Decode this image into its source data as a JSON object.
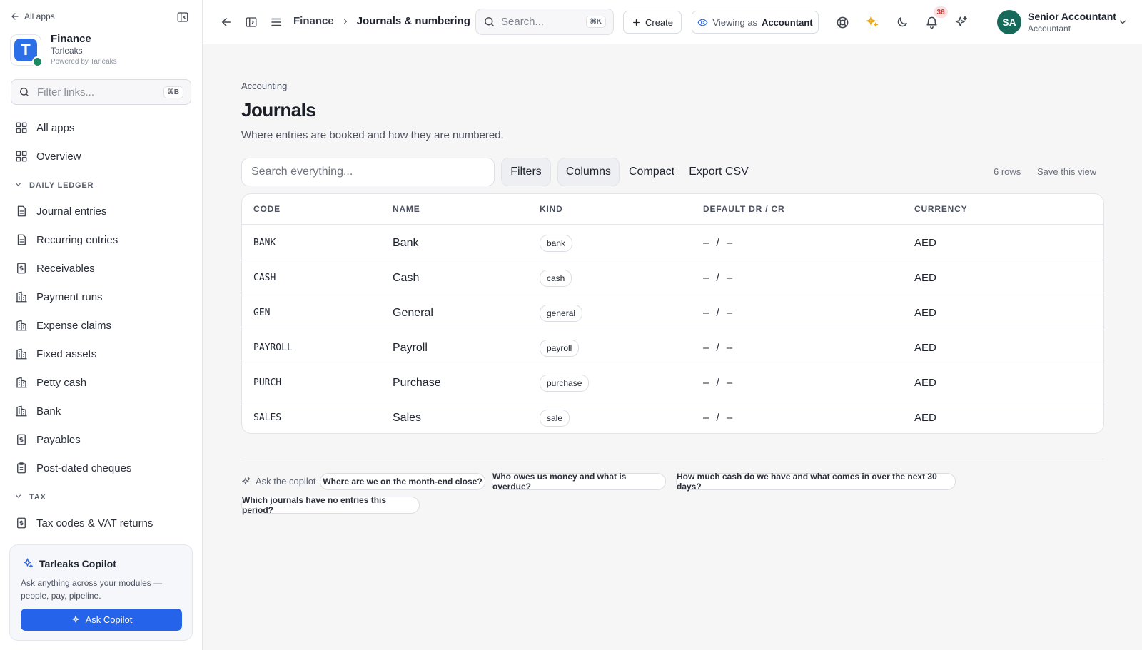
{
  "sidebar": {
    "back_label": "All apps",
    "brand": {
      "logo_letter": "T",
      "title": "Finance",
      "subtitle": "Tarleaks",
      "powered": "Powered by Tarleaks"
    },
    "filter": {
      "placeholder": "Filter links...",
      "shortcut": "⌘B"
    },
    "top_items": [
      {
        "label": "All apps",
        "icon": "grid-icon"
      },
      {
        "label": "Overview",
        "icon": "grid-icon"
      }
    ],
    "sections": [
      {
        "title": "DAILY LEDGER",
        "items": [
          {
            "label": "Journal entries",
            "icon": "document-icon"
          },
          {
            "label": "Recurring entries",
            "icon": "document-icon"
          },
          {
            "label": "Receivables",
            "icon": "dollar-document-icon"
          },
          {
            "label": "Payment runs",
            "icon": "building-icon"
          },
          {
            "label": "Expense claims",
            "icon": "building-icon"
          },
          {
            "label": "Fixed assets",
            "icon": "building-icon"
          },
          {
            "label": "Petty cash",
            "icon": "building-icon"
          },
          {
            "label": "Bank",
            "icon": "building-icon"
          },
          {
            "label": "Payables",
            "icon": "dollar-document-icon"
          },
          {
            "label": "Post-dated cheques",
            "icon": "clipboard-icon"
          }
        ]
      },
      {
        "title": "TAX",
        "items": [
          {
            "label": "Tax codes & VAT returns",
            "icon": "dollar-document-icon"
          }
        ]
      }
    ],
    "copilot": {
      "title": "Tarleaks Copilot",
      "desc": "Ask anything across your modules — people, pay, pipeline.",
      "button": "Ask Copilot"
    }
  },
  "topbar": {
    "breadcrumb": [
      "Finance",
      "Journals & numbering"
    ],
    "search": {
      "placeholder": "Search...",
      "shortcut": "⌘K"
    },
    "create_label": "Create",
    "viewing_prefix": "Viewing as",
    "viewing_role": "Accountant",
    "notifications_count": "36",
    "user": {
      "initials": "SA",
      "name": "Senior Accountant",
      "role": "Accountant"
    }
  },
  "page": {
    "kicker": "Accounting",
    "title": "Journals",
    "description": "Where entries are booked and how they are numbered.",
    "toolbar": {
      "search_placeholder": "Search everything...",
      "filters": "Filters",
      "columns": "Columns",
      "compact": "Compact",
      "export": "Export CSV",
      "rows_count": "6 rows",
      "save_view": "Save this view"
    },
    "table": {
      "columns": [
        "CODE",
        "NAME",
        "KIND",
        "DEFAULT DR / CR",
        "CURRENCY"
      ],
      "rows": [
        {
          "code": "BANK",
          "name": "Bank",
          "kind": "bank",
          "drcr": "– / –",
          "currency": "AED"
        },
        {
          "code": "CASH",
          "name": "Cash",
          "kind": "cash",
          "drcr": "– / –",
          "currency": "AED"
        },
        {
          "code": "GEN",
          "name": "General",
          "kind": "general",
          "drcr": "– / –",
          "currency": "AED"
        },
        {
          "code": "PAYROLL",
          "name": "Payroll",
          "kind": "payroll",
          "drcr": "– / –",
          "currency": "AED"
        },
        {
          "code": "PURCH",
          "name": "Purchase",
          "kind": "purchase",
          "drcr": "– / –",
          "currency": "AED"
        },
        {
          "code": "SALES",
          "name": "Sales",
          "kind": "sale",
          "drcr": "– / –",
          "currency": "AED"
        }
      ]
    },
    "copilot_prompts": {
      "label": "Ask the copilot",
      "chips": [
        "Where are we on the month-end close?",
        "Who owes us money and what is overdue?",
        "How much cash do we have and what comes in over the next 30 days?",
        "Which journals have no entries this period?"
      ]
    }
  },
  "colors": {
    "accent": "#2563eb",
    "avatar": "#17695a",
    "badge": "#d32f2f",
    "spark": "#f0a81c"
  }
}
